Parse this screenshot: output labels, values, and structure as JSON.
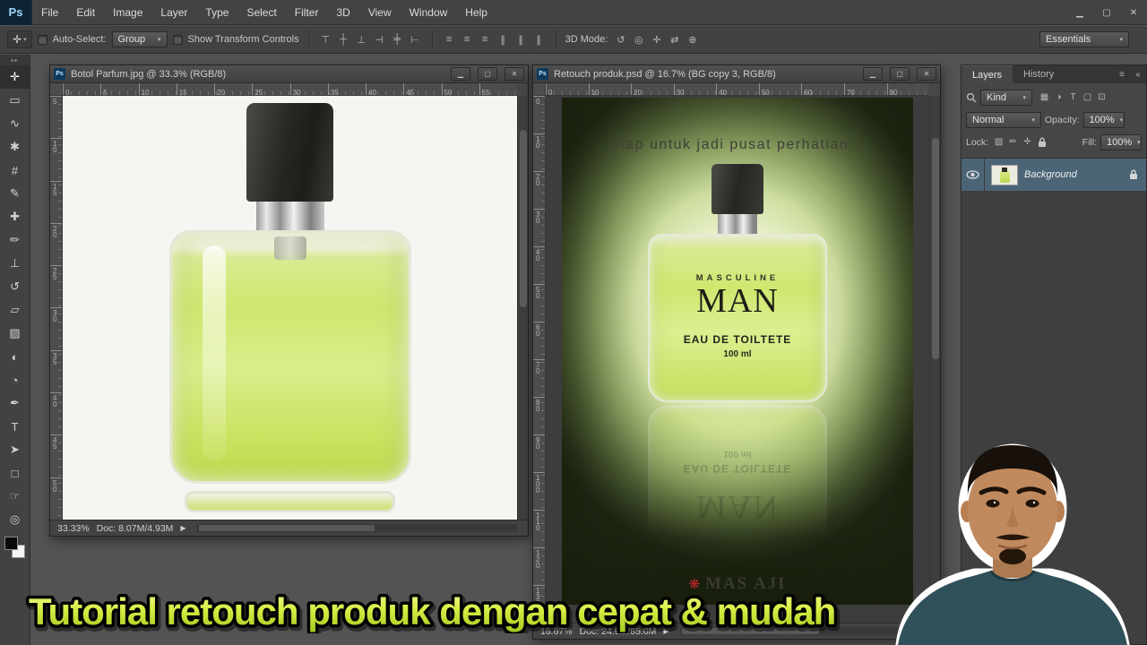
{
  "window_glyphs": {
    "minimize": "▁",
    "restore": "▢",
    "close": "✕"
  },
  "icons": {
    "dropdown": "▾",
    "menu_arrow": "▶",
    "collapse": "«",
    "panel_menu": "≡",
    "toolbar_collapse": "▸▸"
  },
  "titlebar": {
    "logo": "Ps",
    "menus": [
      "File",
      "Edit",
      "Image",
      "Layer",
      "Type",
      "Select",
      "Filter",
      "3D",
      "View",
      "Window",
      "Help"
    ]
  },
  "options_bar": {
    "auto_select_label": "Auto-Select:",
    "auto_select_value": "Group",
    "show_transform_label": "Show Transform Controls",
    "align_icons": [
      {
        "name": "align-top-edges-icon",
        "glyph": "⊤"
      },
      {
        "name": "align-vertical-centers-icon",
        "glyph": "┼"
      },
      {
        "name": "align-bottom-edges-icon",
        "glyph": "⊥"
      },
      {
        "name": "align-left-edges-icon",
        "glyph": "⊣"
      },
      {
        "name": "align-horizontal-centers-icon",
        "glyph": "╪"
      },
      {
        "name": "align-right-edges-icon",
        "glyph": "⊢"
      }
    ],
    "distribute_icons": [
      {
        "name": "distribute-top-edges-icon",
        "glyph": "≡"
      },
      {
        "name": "distribute-vertical-centers-icon",
        "glyph": "≡"
      },
      {
        "name": "distribute-bottom-edges-icon",
        "glyph": "≡"
      },
      {
        "name": "distribute-left-edges-icon",
        "glyph": "∥"
      },
      {
        "name": "distribute-horizontal-centers-icon",
        "glyph": "∥"
      },
      {
        "name": "distribute-right-edges-icon",
        "glyph": "∥"
      }
    ],
    "threed_label": "3D Mode:",
    "threed_icons": [
      {
        "name": "3d-rotate-camera-icon",
        "glyph": "↺"
      },
      {
        "name": "3d-roll-camera-icon",
        "glyph": "◎"
      },
      {
        "name": "3d-pan-camera-icon",
        "glyph": "✛"
      },
      {
        "name": "3d-slide-camera-icon",
        "glyph": "⇄"
      },
      {
        "name": "3d-zoom-camera-icon",
        "glyph": "⊕"
      }
    ],
    "workspace": "Essentials"
  },
  "toolbar": {
    "tools": [
      {
        "name": "move-tool",
        "glyph": "✛"
      },
      {
        "name": "rectangular-marquee-tool",
        "glyph": "▭"
      },
      {
        "name": "lasso-tool",
        "glyph": "∿"
      },
      {
        "name": "quick-selection-tool",
        "glyph": "✱"
      },
      {
        "name": "crop-tool",
        "glyph": "#"
      },
      {
        "name": "eyedropper-tool",
        "glyph": "✎"
      },
      {
        "name": "spot-healing-brush-tool",
        "glyph": "✚"
      },
      {
        "name": "brush-tool",
        "glyph": "✏"
      },
      {
        "name": "clone-stamp-tool",
        "glyph": "⊥"
      },
      {
        "name": "history-brush-tool",
        "glyph": "↺"
      },
      {
        "name": "eraser-tool",
        "glyph": "▱"
      },
      {
        "name": "gradient-tool",
        "glyph": "▨"
      },
      {
        "name": "blur-tool",
        "glyph": "◐"
      },
      {
        "name": "dodge-tool",
        "glyph": "◔"
      },
      {
        "name": "pen-tool",
        "glyph": "✒"
      },
      {
        "name": "horizontal-type-tool",
        "glyph": "T"
      },
      {
        "name": "path-selection-tool",
        "glyph": "➤"
      },
      {
        "name": "rectangle-tool",
        "glyph": "□"
      },
      {
        "name": "hand-tool",
        "glyph": "☞"
      },
      {
        "name": "zoom-tool",
        "glyph": "◎"
      }
    ]
  },
  "doc1": {
    "title": "Botol Parfum.jpg @ 33.3% (RGB/8)",
    "zoom": "33.33%",
    "doc_info": "Doc: 8.07M/4.93M",
    "ruler_h": [
      0,
      5,
      10,
      15,
      20,
      25,
      30,
      35,
      40,
      45,
      50,
      55
    ],
    "ruler_v": [
      5,
      10,
      15,
      20,
      25,
      30,
      35,
      40,
      45,
      50
    ]
  },
  "doc2": {
    "title": "Retouch produk.psd @ 16.7% (BG copy 3, RGB/8)",
    "zoom": "16.67%",
    "doc_info": "Doc: 24.9M/85.0M",
    "ruler_h": [
      0,
      10,
      20,
      30,
      40,
      50,
      60,
      70,
      80
    ],
    "ruler_v": [
      0,
      10,
      20,
      30,
      40,
      50,
      60,
      70,
      80,
      90,
      100,
      110,
      120,
      130
    ],
    "poster": {
      "headline": "Siap untuk jadi pusat perhatian...",
      "label_top": "MASCULINE",
      "label_main": "MAN",
      "label_sub": "EAU DE TOILTETE",
      "label_size": "100 ml",
      "brand": "MAS AJI"
    }
  },
  "panels": {
    "tabs": [
      "Layers",
      "History"
    ],
    "kind_label": "Kind",
    "filter_icons": [
      {
        "name": "filter-pixel-layers-icon",
        "glyph": "▦"
      },
      {
        "name": "filter-adjustment-layers-icon",
        "glyph": "◑"
      },
      {
        "name": "filter-type-layers-icon",
        "glyph": "T"
      },
      {
        "name": "filter-shape-layers-icon",
        "glyph": "▢"
      },
      {
        "name": "filter-smart-objects-icon",
        "glyph": "⊡"
      }
    ],
    "blend_mode": "Normal",
    "opacity_label": "Opacity:",
    "opacity_value": "100%",
    "lock_label": "Lock:",
    "lock_icons": [
      {
        "name": "lock-transparent-pixels-icon",
        "glyph": "▨"
      },
      {
        "name": "lock-image-pixels-icon",
        "glyph": "✏"
      },
      {
        "name": "lock-position-icon",
        "glyph": "✛"
      }
    ],
    "fill_label": "Fill:",
    "fill_value": "100%",
    "layers": [
      {
        "name": "Background",
        "visible": true,
        "locked": true
      }
    ]
  },
  "caption": "Tutorial retouch produk dengan cepat & mudah",
  "colors": {
    "liquid_green": "#cfe76f",
    "ui_dark": "#424242",
    "ps_blue": "#9fd6ff",
    "caption_top": "#f2fa8a",
    "caption_bottom": "#a2c81c",
    "brand_red": "#c1272d",
    "selected_layer": "#4b6577"
  }
}
